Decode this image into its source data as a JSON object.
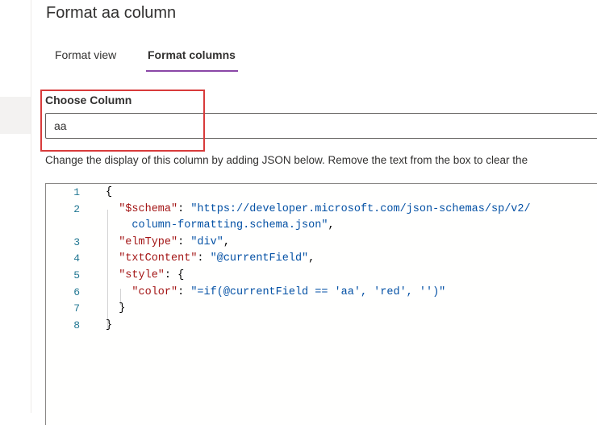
{
  "panel": {
    "title": "Format aa column"
  },
  "tabs": [
    {
      "label": "Format view",
      "active": false
    },
    {
      "label": "Format columns",
      "active": true
    }
  ],
  "column_chooser": {
    "label": "Choose Column",
    "value": "aa"
  },
  "description": "Change the display of this column by adding JSON below. Remove the text from the box to clear the",
  "editor": {
    "line_numbers": [
      "1",
      "2",
      "",
      "3",
      "4",
      "5",
      "6",
      "7",
      "8"
    ],
    "lines": [
      [
        {
          "t": "p",
          "v": "{"
        }
      ],
      [
        {
          "t": "k",
          "v": "  \"$schema\""
        },
        {
          "t": "p",
          "v": ": "
        },
        {
          "t": "s",
          "v": "\"https://developer.microsoft.com/json-schemas/sp/v2/"
        }
      ],
      [
        {
          "t": "s",
          "v": "    column-formatting.schema.json\""
        },
        {
          "t": "p",
          "v": ","
        }
      ],
      [
        {
          "t": "k",
          "v": "  \"elmType\""
        },
        {
          "t": "p",
          "v": ": "
        },
        {
          "t": "s",
          "v": "\"div\""
        },
        {
          "t": "p",
          "v": ","
        }
      ],
      [
        {
          "t": "k",
          "v": "  \"txtContent\""
        },
        {
          "t": "p",
          "v": ": "
        },
        {
          "t": "s",
          "v": "\"@currentField\""
        },
        {
          "t": "p",
          "v": ","
        }
      ],
      [
        {
          "t": "k",
          "v": "  \"style\""
        },
        {
          "t": "p",
          "v": ": {"
        }
      ],
      [
        {
          "t": "k",
          "v": "    \"color\""
        },
        {
          "t": "p",
          "v": ": "
        },
        {
          "t": "s",
          "v": "\"=if(@currentField == 'aa', 'red', '')\""
        }
      ],
      [
        {
          "t": "p",
          "v": "  }"
        }
      ],
      [
        {
          "t": "p",
          "v": "}"
        }
      ]
    ]
  },
  "colors": {
    "accent": "#8a47a7",
    "highlight": "#d83b3b",
    "json_key": "#a31515",
    "json_string": "#0451a5",
    "line_number": "#237893"
  }
}
